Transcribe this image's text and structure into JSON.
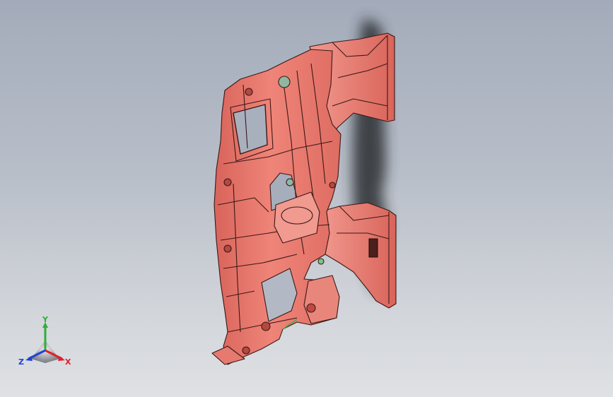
{
  "viewport": {
    "background_top": "#a3abba",
    "background_bottom": "#dfe1e4"
  },
  "model": {
    "name": "",
    "face_color": "#e8776c",
    "edge_color": "#3a1816",
    "shadow_color": "#25282d"
  },
  "triad": {
    "x_label": "X",
    "y_label": "Y",
    "z_label": "Z",
    "x_color": "#e0202a",
    "y_color": "#2fae3a",
    "z_color": "#2040d8"
  }
}
